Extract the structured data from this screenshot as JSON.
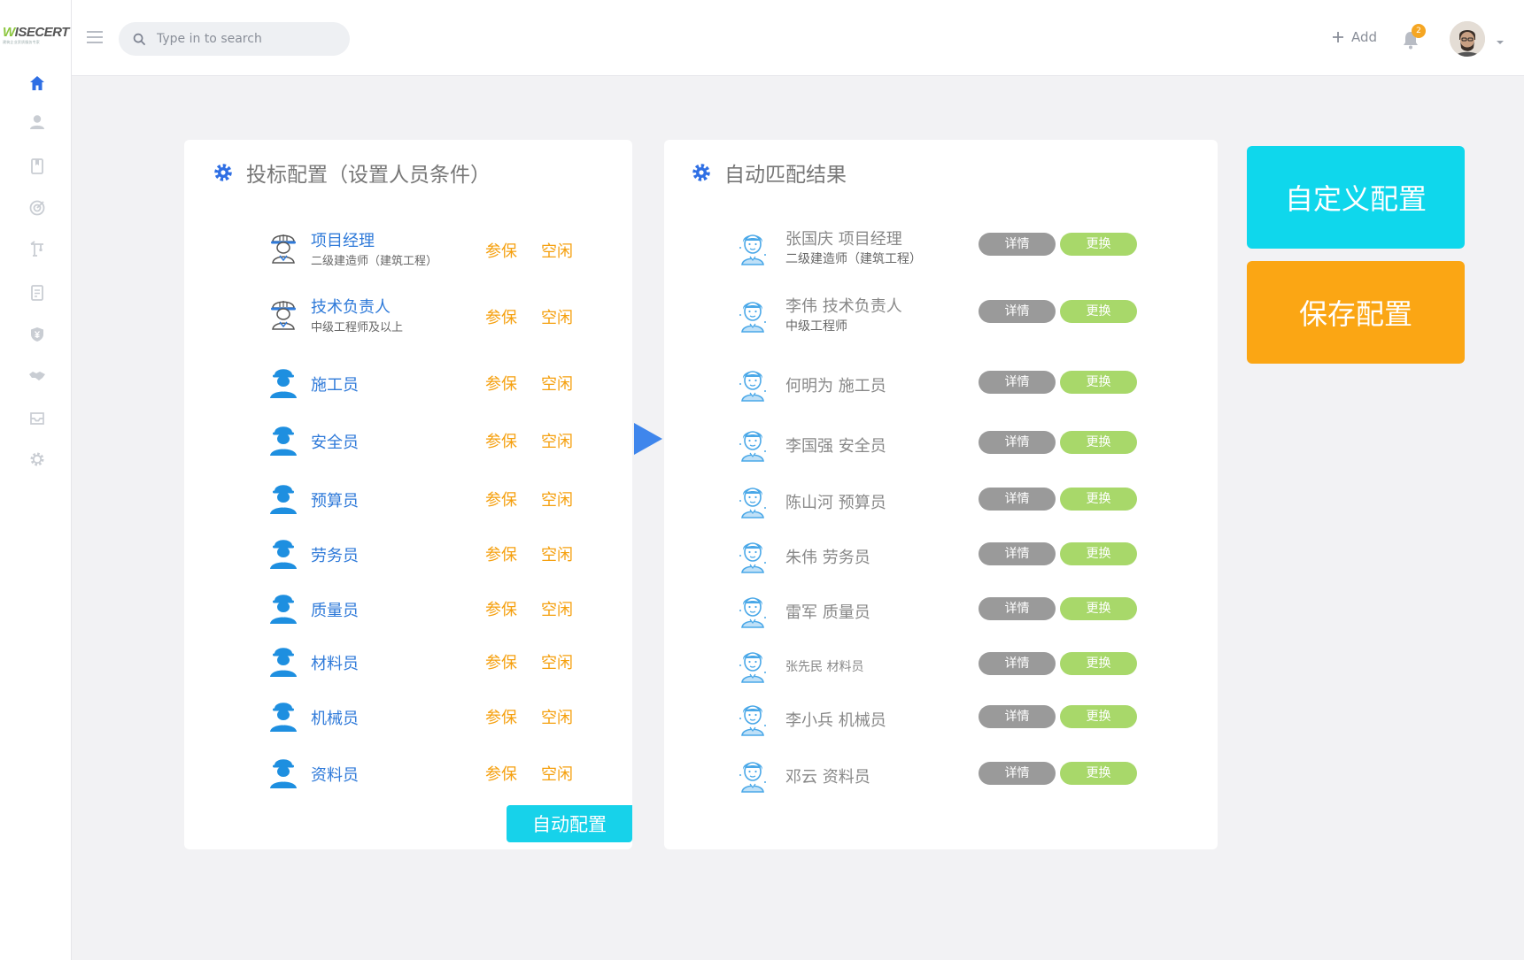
{
  "brand": {
    "logo_text": "WISECERT",
    "logo_sub": "建筑企业资质服务专家"
  },
  "sidebar": {
    "items": [
      {
        "icon": "home-icon",
        "active": true
      },
      {
        "icon": "user-icon"
      },
      {
        "icon": "bookmark-icon"
      },
      {
        "icon": "target-icon"
      },
      {
        "icon": "crane-icon"
      },
      {
        "icon": "document-icon"
      },
      {
        "icon": "shield-yen-icon"
      },
      {
        "icon": "handshake-icon"
      },
      {
        "icon": "inbox-icon"
      },
      {
        "icon": "settings-icon"
      }
    ]
  },
  "header": {
    "search_placeholder": "Type in to search",
    "add_label": "Add",
    "notification_count": "2"
  },
  "left_panel": {
    "title": "投标配置（设置人员条件）",
    "rows": [
      {
        "name": "项目经理",
        "sub": "二级建造师（建筑工程）",
        "tag1": "参保",
        "tag2": "空闲",
        "icon": "hardhat-worker-icon"
      },
      {
        "name": "技术负责人",
        "sub": "中级工程师及以上",
        "tag1": "参保",
        "tag2": "空闲",
        "icon": "hardhat-worker-icon"
      },
      {
        "name": "施工员",
        "sub": "",
        "tag1": "参保",
        "tag2": "空闲",
        "icon": "worker-icon"
      },
      {
        "name": "安全员",
        "sub": "",
        "tag1": "参保",
        "tag2": "空闲",
        "icon": "worker-icon"
      },
      {
        "name": "预算员",
        "sub": "",
        "tag1": "参保",
        "tag2": "空闲",
        "icon": "worker-icon"
      },
      {
        "name": "劳务员",
        "sub": "",
        "tag1": "参保",
        "tag2": "空闲",
        "icon": "worker-icon"
      },
      {
        "name": "质量员",
        "sub": "",
        "tag1": "参保",
        "tag2": "空闲",
        "icon": "worker-icon"
      },
      {
        "name": "材料员",
        "sub": "",
        "tag1": "参保",
        "tag2": "空闲",
        "icon": "worker-icon"
      },
      {
        "name": "机械员",
        "sub": "",
        "tag1": "参保",
        "tag2": "空闲",
        "icon": "worker-icon"
      },
      {
        "name": "资料员",
        "sub": "",
        "tag1": "参保",
        "tag2": "空闲",
        "icon": "worker-icon"
      }
    ],
    "auto_button": "自动配置"
  },
  "right_panel": {
    "title": "自动匹配结果",
    "detail_label": "详情",
    "swap_label": "更换",
    "rows": [
      {
        "name": "张国庆  项目经理",
        "sub": "二级建造师（建筑工程）"
      },
      {
        "name": "李伟  技术负责人",
        "sub": "中级工程师"
      },
      {
        "name": "何明为 施工员",
        "sub": ""
      },
      {
        "name": "李国强  安全员",
        "sub": ""
      },
      {
        "name": "陈山河  预算员",
        "sub": ""
      },
      {
        "name": "朱伟  劳务员",
        "sub": ""
      },
      {
        "name": "雷军  质量员",
        "sub": ""
      },
      {
        "name": "张先民  材料员",
        "sub": "",
        "small": true
      },
      {
        "name": "李小兵  机械员",
        "sub": ""
      },
      {
        "name": "邓云  资料员",
        "sub": ""
      }
    ]
  },
  "actions": {
    "custom_config": "自定义配置",
    "save_config": "保存配置"
  },
  "colors": {
    "primary_blue": "#2f7ad9",
    "tag_orange": "#f5a00f",
    "cyan": "#0fd7ec",
    "orange": "#fba614",
    "detail_gray": "#9a9a9a",
    "swap_green": "#a8d86a"
  }
}
